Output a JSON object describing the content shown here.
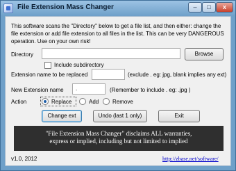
{
  "window": {
    "title": "File Extension Mass Changer",
    "controls": {
      "minimize": "–",
      "maximize": "□",
      "close": "x"
    }
  },
  "intro": "This software scans the \"Directory\" below to get a file list, and then either: change the file extension  or add file extension to all files in the list. This can be very DANGEROUS operation. Use on your own risk!",
  "directory": {
    "label": "Directory",
    "value": "",
    "browse_label": "Browse"
  },
  "subdirectory": {
    "label": "Include subdirectory",
    "checked": false
  },
  "ext_replace": {
    "label": "Extension name to be replaced",
    "value": "",
    "hint": "(exclude . eg: jpg, blank implies any ext)"
  },
  "ext_new": {
    "label": "New Extension name",
    "value": ".",
    "hint": "(Remember to include . eg:  .jpg )"
  },
  "action": {
    "label": "Action",
    "options": [
      "Replace",
      "Add",
      "Remove"
    ],
    "selected": "Replace"
  },
  "buttons": {
    "change": "Change ext",
    "undo": "Undo (last 1 only)",
    "exit": "Exit"
  },
  "disclaimer": {
    "line1": "\"File Extension Mass Changer\" disclaims ALL warranties,",
    "line2": "express or implied, including but not limited to implied"
  },
  "footer": {
    "version": "v1.0, 2012",
    "link": "http://zbase.net/software/"
  },
  "colors": {
    "titlebar": "#6fa0c9",
    "banner": "#2f2f2f",
    "link": "#0000cc"
  }
}
